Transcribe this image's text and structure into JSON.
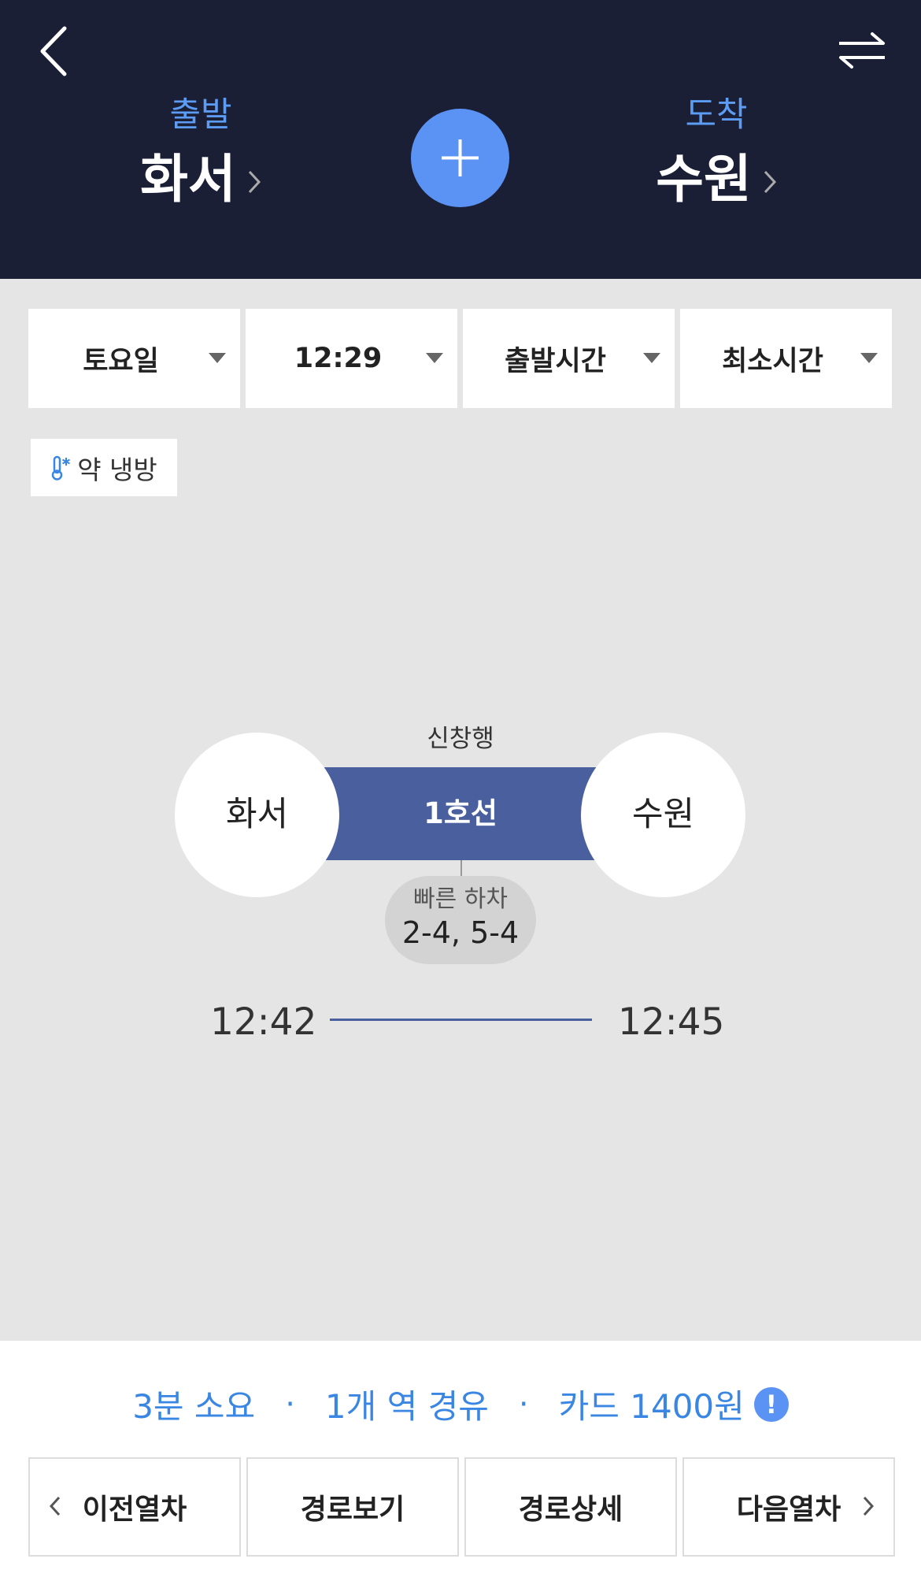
{
  "header": {
    "origin": {
      "caption": "출발",
      "name": "화서"
    },
    "destination": {
      "caption": "도착",
      "name": "수원"
    },
    "add_icon": "plus-icon",
    "back_icon": "back-icon",
    "swap_icon": "swap-icon"
  },
  "filters": [
    {
      "label": "토요일"
    },
    {
      "label": "12:29"
    },
    {
      "label": "출발시간"
    },
    {
      "label": "최소시간"
    }
  ],
  "ac_badge": {
    "label": "약 냉방",
    "icon": "thermometer-snow-icon"
  },
  "route": {
    "direction": "신창행",
    "line_name": "1호선",
    "from_station": "화서",
    "to_station": "수원",
    "fast_exit_title": "빠른 하차",
    "fast_exit_doors": "2-4, 5-4",
    "depart_time": "12:42",
    "arrive_time": "12:45"
  },
  "summary": {
    "duration": "3분 소요",
    "stops": "1개 역 경유",
    "fare": "카드 1400원",
    "separator": "·",
    "info_glyph": "!"
  },
  "actions": [
    {
      "label": "이전열차"
    },
    {
      "label": "경로보기"
    },
    {
      "label": "경로상세"
    },
    {
      "label": "다음열차"
    }
  ],
  "colors": {
    "header_bg": "#1a1f35",
    "accent_blue": "#5b93f4",
    "line_1_color": "#4a5f9e",
    "summary_text": "#3a86e3"
  }
}
